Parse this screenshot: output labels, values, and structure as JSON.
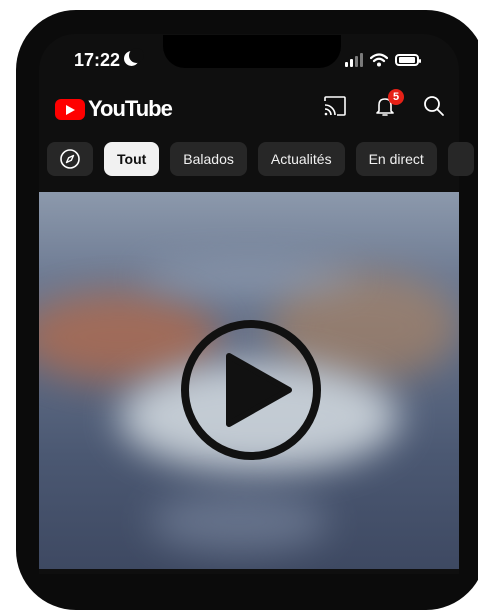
{
  "status_bar": {
    "time": "17:22"
  },
  "header": {
    "logo_text": "YouTube",
    "notification_count": "5",
    "icons": [
      "cast-icon",
      "bell-icon",
      "search-icon"
    ]
  },
  "chips": {
    "items": [
      {
        "label": "Tout",
        "active": true
      },
      {
        "label": "Balados",
        "active": false
      },
      {
        "label": "Actualités",
        "active": false
      },
      {
        "label": "En direct",
        "active": false
      }
    ]
  },
  "colors": {
    "brand_red": "#ff0000",
    "badge_red": "#e62117",
    "background": "#0f0f0f",
    "chip_bg": "#272727",
    "chip_active_bg": "#f1f1f1"
  }
}
